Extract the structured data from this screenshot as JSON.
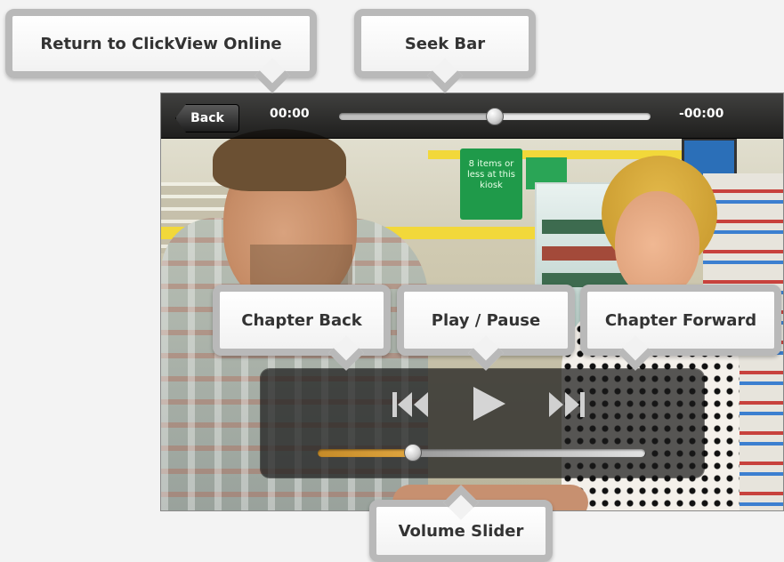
{
  "player": {
    "back_label": "Back",
    "elapsed_time": "00:00",
    "remaining_time": "-00:00",
    "seek_progress": 0.5,
    "volume_level": 0.29
  },
  "video_overlay": {
    "kiosk_sign": "8 items or less at this kiosk"
  },
  "controls": {
    "chapter_back_icon": "skip-back-icon",
    "play_icon": "play-icon",
    "chapter_forward_icon": "skip-forward-icon"
  },
  "callouts": {
    "return": "Return to ClickView Online",
    "seek_bar": "Seek Bar",
    "chapter_back": "Chapter Back",
    "play_pause": "Play / Pause",
    "chapter_forward": "Chapter Forward",
    "volume_slider": "Volume Slider"
  },
  "colors": {
    "callout_border": "#b9b9b9",
    "volume_fill": "#e0a640"
  }
}
